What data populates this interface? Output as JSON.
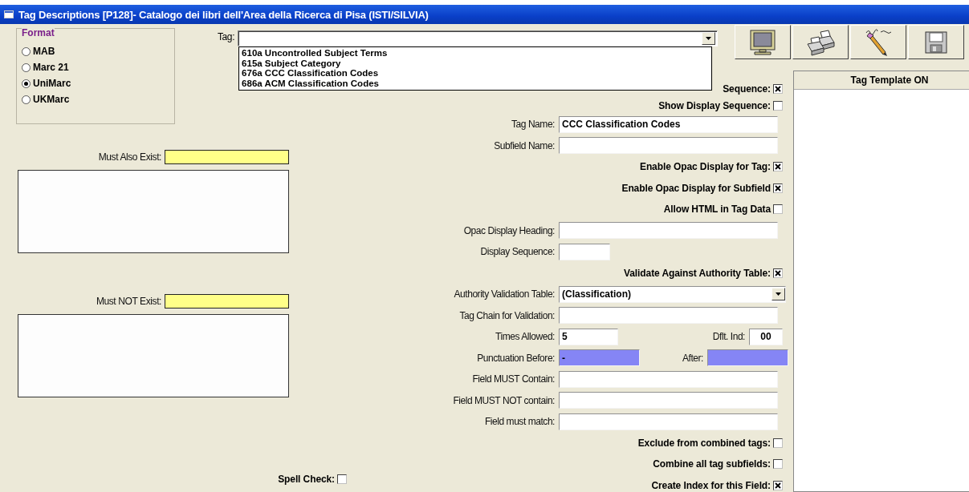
{
  "window": {
    "title": "Tag Descriptions  [P128]- Catalogo dei libri dell'Area della Ricerca di Pisa  (ISTI/SILVIA)"
  },
  "format": {
    "title": "Format",
    "options": [
      {
        "label": "MAB",
        "selected": false
      },
      {
        "label": "Marc 21",
        "selected": false
      },
      {
        "label": "UniMarc",
        "selected": true
      },
      {
        "label": "UKMarc",
        "selected": false
      }
    ]
  },
  "tag": {
    "label": "Tag:",
    "dropdown": [
      {
        "label": "610a Uncontrolled Subject Terms"
      },
      {
        "label": "615a Subject Category"
      },
      {
        "label": "676a CCC Classification Codes"
      },
      {
        "label": "686a ACM Classification Codes"
      }
    ]
  },
  "toolbar": [
    {
      "kind": "monitor"
    },
    {
      "kind": "printer"
    },
    {
      "kind": "pencil"
    },
    {
      "kind": "save"
    }
  ],
  "must_also_exist": {
    "label": "Must Also Exist:"
  },
  "must_not_exist": {
    "label": "Must NOT Exist:"
  },
  "spell_check": {
    "label": "Spell Check:",
    "checked": false
  },
  "fields": [
    {
      "kind": "check",
      "label": "Sequence:",
      "checked": true
    },
    {
      "kind": "check",
      "label": "Show Display Sequence:",
      "checked": false
    },
    {
      "kind": "text",
      "label": "Tag Name:",
      "value": "CCC Classification Codes"
    },
    {
      "kind": "text",
      "label": "Subfield Name:"
    },
    {
      "kind": "check",
      "label": "Enable Opac Display for Tag:",
      "checked": true
    },
    {
      "kind": "check",
      "label": "Enable Opac Display for Subfield",
      "checked": true
    },
    {
      "kind": "check",
      "label": "Allow HTML in Tag Data",
      "checked": false
    },
    {
      "kind": "text",
      "label": "Opac Display Heading:"
    },
    {
      "kind": "short",
      "label": "Display Sequence:"
    },
    {
      "kind": "check",
      "label": "Validate Against Authority Table:",
      "checked": true
    },
    {
      "kind": "select",
      "label": "Authority Validation Table:",
      "value": "(Classification)"
    },
    {
      "kind": "text",
      "label": "Tag Chain for Validation:"
    },
    {
      "kind": "pair",
      "parts": [
        {
          "label": "Times Allowed:",
          "value": "5"
        },
        {
          "label": "Dflt. Ind:",
          "value": "00"
        }
      ]
    },
    {
      "kind": "punct",
      "parts": [
        {
          "label": "Punctuation Before:",
          "value": "-"
        },
        {
          "label": "After:"
        }
      ]
    },
    {
      "kind": "text",
      "label": "Field MUST Contain:"
    },
    {
      "kind": "text",
      "label": "Field MUST NOT contain:"
    },
    {
      "kind": "text",
      "label": "Field must match:"
    },
    {
      "kind": "check",
      "label": "Exclude from combined tags:",
      "checked": false
    },
    {
      "kind": "check",
      "label": "Combine all tag subfields:",
      "checked": false
    },
    {
      "kind": "check",
      "label": "Create Index for this Field:",
      "checked": true
    }
  ],
  "template_panel": {
    "header": "Tag Template ON"
  }
}
